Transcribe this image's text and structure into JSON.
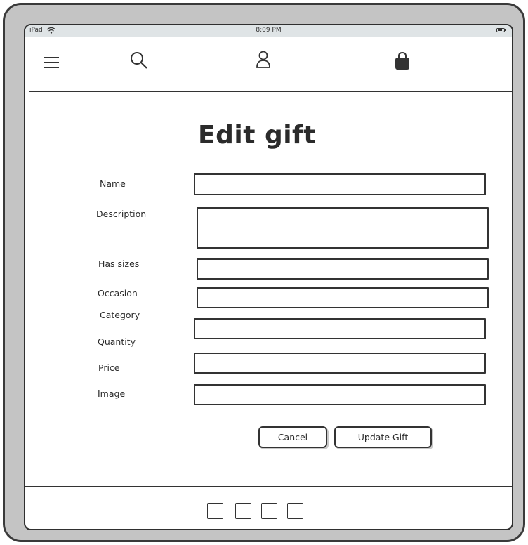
{
  "status_bar": {
    "device": "iPad",
    "time": "8:09 PM"
  },
  "nav": {
    "menu_icon": "hamburger-menu-icon",
    "search_icon": "search-icon",
    "account_icon": "user-icon",
    "bag_icon": "shopping-bag-icon"
  },
  "form": {
    "title": "Edit gift",
    "fields": {
      "name": {
        "label": "Name",
        "value": ""
      },
      "description": {
        "label": "Description",
        "value": ""
      },
      "has_sizes": {
        "label": "Has sizes",
        "value": ""
      },
      "occasion": {
        "label": "Occasion",
        "value": ""
      },
      "category": {
        "label": "Category",
        "value": ""
      },
      "quantity": {
        "label": "Quantity",
        "value": ""
      },
      "price": {
        "label": "Price",
        "value": ""
      },
      "image": {
        "label": "Image",
        "value": ""
      }
    },
    "cancel_label": "Cancel",
    "submit_label": "Update Gift"
  },
  "footer": {
    "page_count": 4
  },
  "colors": {
    "frame": "#c4c4c4",
    "status_bar": "#dfe4e6",
    "ink": "#2b2b2b"
  }
}
